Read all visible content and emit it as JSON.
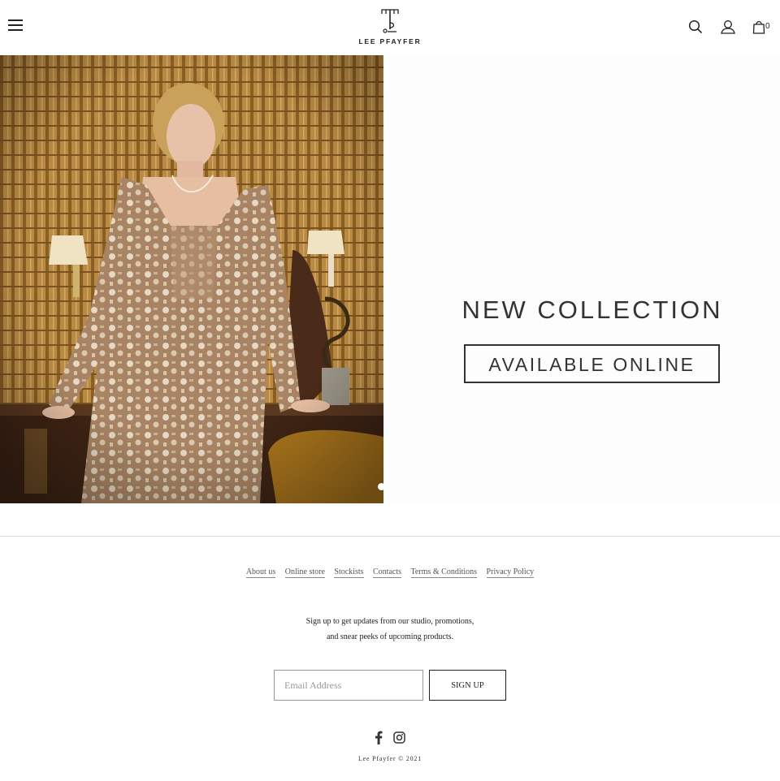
{
  "brand": {
    "name": "LEE  PFAYFER"
  },
  "header": {
    "cart_count": "0"
  },
  "hero": {
    "title": "NEW COLLECTION",
    "cta": "AVAILABLE ONLINE"
  },
  "footer": {
    "links": [
      {
        "label": "About us"
      },
      {
        "label": "Online store"
      },
      {
        "label": "Stockists"
      },
      {
        "label": "Contacts"
      },
      {
        "label": "Terms & Conditions"
      },
      {
        "label": "Privacy Policy"
      }
    ],
    "signup_line1": "Sign up to get updates from our studio, promotions,",
    "signup_line2": "and snear peeks of upcoming products.",
    "email_placeholder": "Email Address",
    "signup_button": "SIGN UP",
    "copyright": "Lee Pfayfer © 2021"
  },
  "icons": {
    "menu": "hamburger-icon",
    "search": "search-icon",
    "account": "user-icon",
    "cart": "shopping-bag-icon",
    "facebook": "facebook-icon",
    "instagram": "instagram-icon"
  }
}
